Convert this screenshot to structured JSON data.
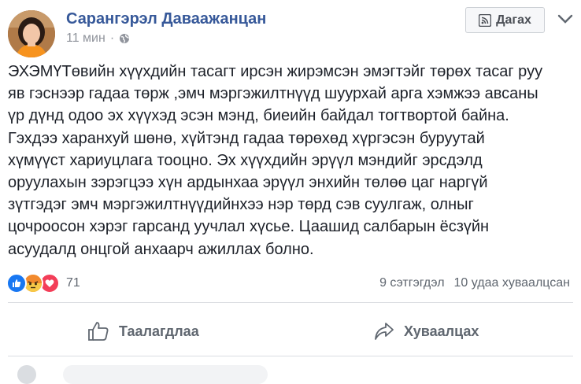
{
  "post": {
    "author": "Сарангэрэл Даваажанцан",
    "time": "11 мин",
    "privacy_icon": "globe-icon",
    "follow_label": "Дагах",
    "text": "ЭХЭМҮТөвийн хүүхдийн тасагт ирсэн жирэмсэн эмэгтэйг төрөх тасаг руу\nяв гэснээр гадаа төрж ,эмч мэргэжилтнүүд шуурхай арга хэмжээ авсаны\nүр дүнд одоо эх хүүхэд эсэн мэнд, биеийн байдал тогтвортой байна.\nГэхдээ харанхуй шөнө, хүйтэнд гадаа төрөхөд хүргэсэн буруутай\nхүмүүст хариуцлага тооцно. Эх хүүхдийн эрүүл мэндийг эрсдэлд\nоруулахын зэрэгцээ хүн ардынхаа эрүүл энхийн төлөө цаг наргүй\nзүтгэдэг эмч мэргэжилтнүүдийнхээ нэр төрд сэв суулгаж, олныг\nцочроосон хэрэг гарсанд уучлал хүсье. Цаашид салбарын ёсзүйн\nасуудалд онцгой анхаарч ажиллах болно."
  },
  "reactions": {
    "count": "71",
    "icons": [
      "like-icon",
      "angry-icon",
      "love-icon"
    ],
    "colors": {
      "like": "#1877f2",
      "angry": "#f5a623",
      "love": "#f33e58"
    }
  },
  "stats": {
    "comments": "9 сэтгэгдэл",
    "shares": "10 удаа хуваалцсан"
  },
  "actions": {
    "like_label": "Таалагдлаа",
    "share_label": "Хуваалцах"
  }
}
